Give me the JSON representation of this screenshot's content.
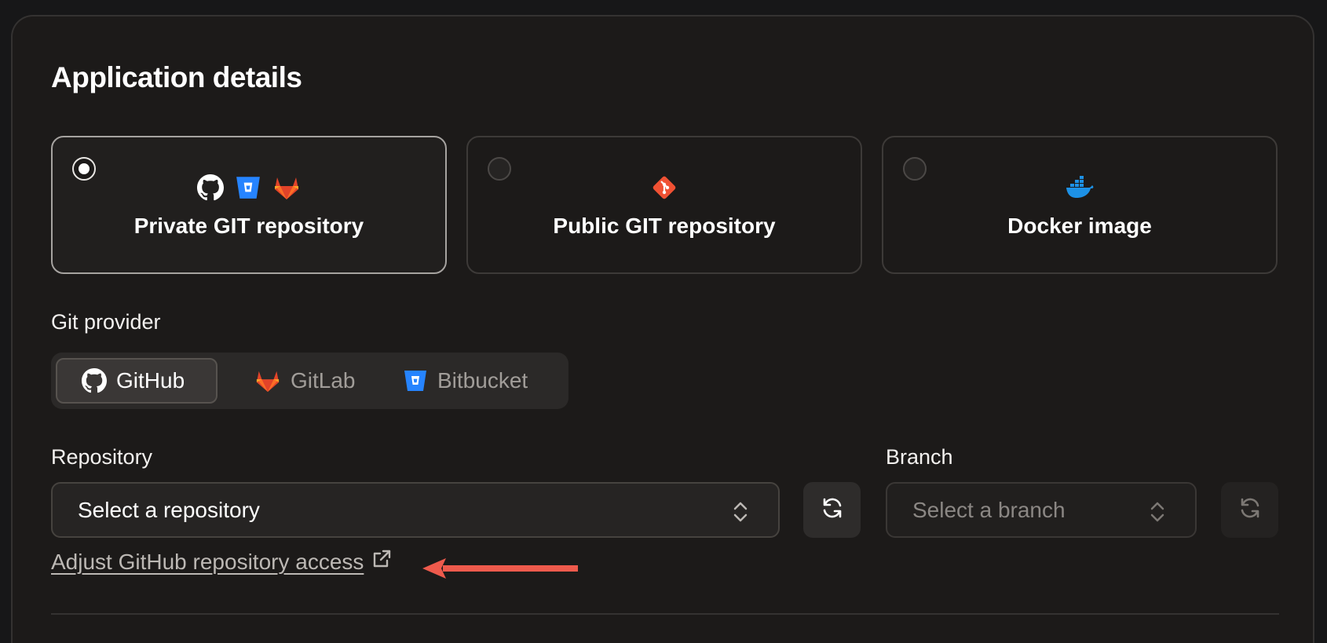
{
  "page": {
    "title": "Application details"
  },
  "source_options": [
    {
      "label": "Private GIT repository",
      "selected": true,
      "icons": [
        "github-icon",
        "bitbucket-icon",
        "gitlab-icon"
      ]
    },
    {
      "label": "Public GIT repository",
      "selected": false,
      "icons": [
        "git-icon"
      ]
    },
    {
      "label": "Docker image",
      "selected": false,
      "icons": [
        "docker-icon"
      ]
    }
  ],
  "git_provider": {
    "label": "Git provider",
    "options": [
      {
        "label": "GitHub",
        "icon": "github-icon",
        "active": true
      },
      {
        "label": "GitLab",
        "icon": "gitlab-icon",
        "active": false
      },
      {
        "label": "Bitbucket",
        "icon": "bitbucket-icon",
        "active": false
      }
    ]
  },
  "repository": {
    "label": "Repository",
    "placeholder": "Select a repository",
    "refresh_icon": "refresh-icon",
    "access_link": "Adjust GitHub repository access",
    "access_link_icon": "external-link-icon"
  },
  "branch": {
    "label": "Branch",
    "placeholder": "Select a branch",
    "refresh_icon": "refresh-icon",
    "disabled": true
  },
  "colors": {
    "background": "#1c1a19",
    "annotation_arrow": "#ee5a4c",
    "github": "#ffffff",
    "bitbucket": "#2684ff",
    "gitlab": "#fc6d26",
    "git": "#f05133",
    "docker": "#1d91e6"
  }
}
